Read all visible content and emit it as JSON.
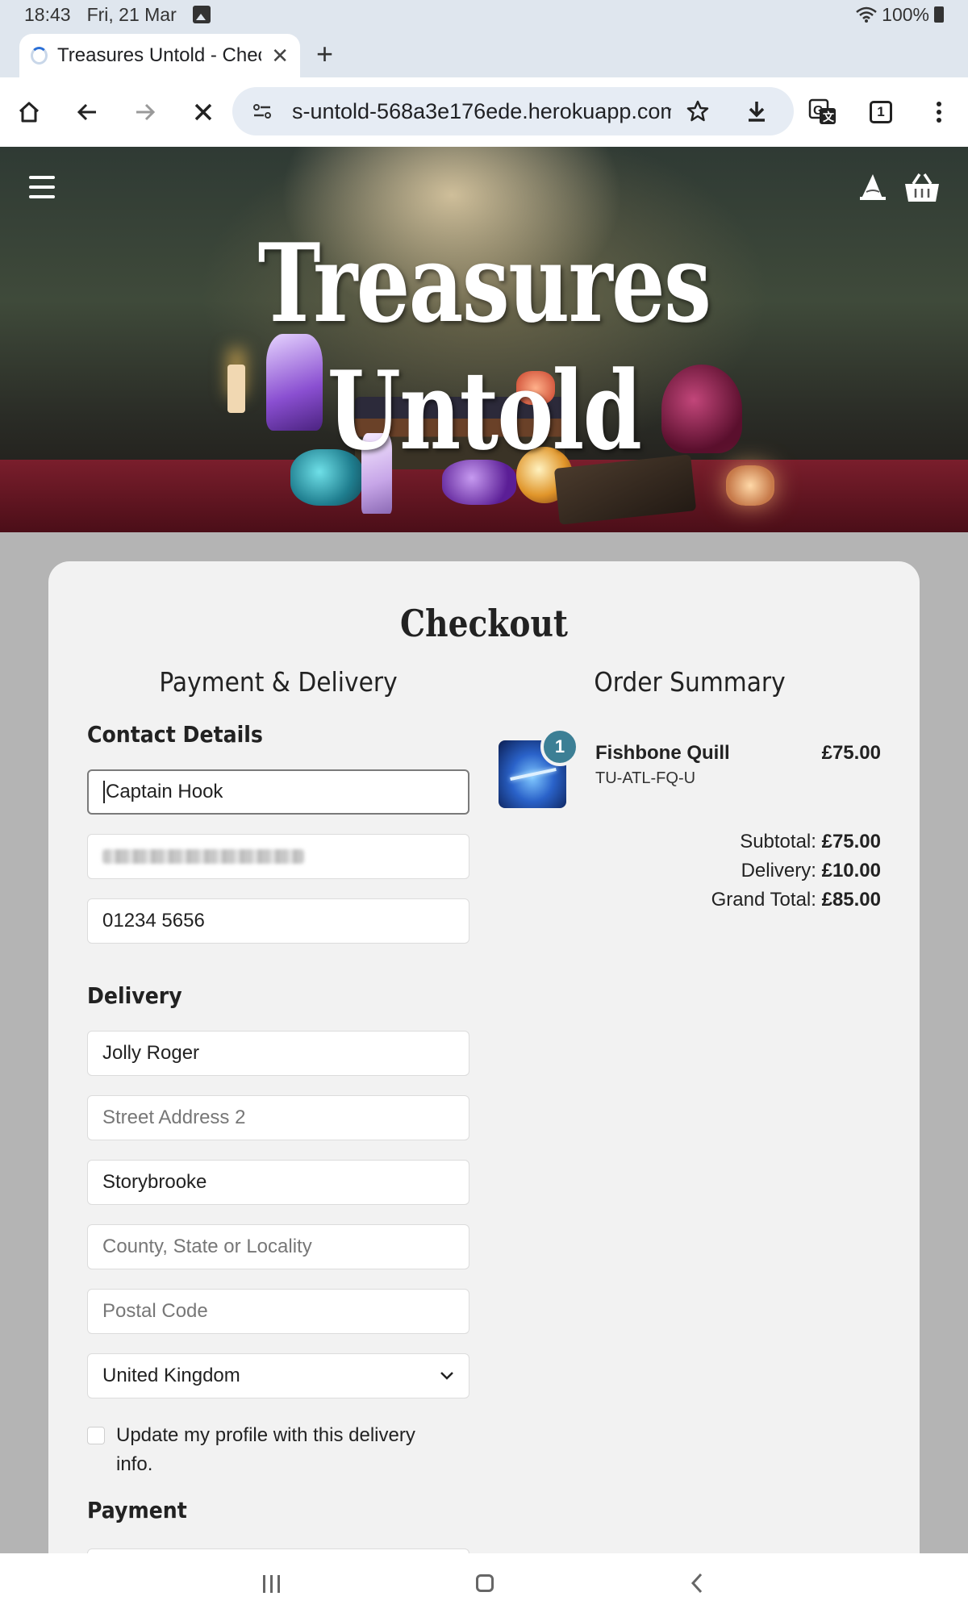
{
  "status_bar": {
    "time": "18:43",
    "date": "Fri, 21 Mar",
    "battery": "100%"
  },
  "browser": {
    "tab_title": "Treasures Untold - Checkout",
    "url": "s-untold-568a3e176ede.herokuapp.com",
    "tab_count": "1",
    "icons": [
      "home-icon",
      "back-icon",
      "forward-icon",
      "stop-icon",
      "site-settings-icon",
      "bookmark-star-icon",
      "download-icon",
      "translate-icon",
      "tabs-icon",
      "more-icon"
    ]
  },
  "site": {
    "brand": "Treasures Untold",
    "icons": [
      "menu-icon",
      "wizard-hat-icon",
      "basket-icon"
    ]
  },
  "checkout": {
    "title": "Checkout",
    "payment_delivery_heading": "Payment & Delivery",
    "order_summary_heading": "Order Summary",
    "contact_heading": "Contact Details",
    "contact": {
      "full_name": "Captain Hook",
      "email": "",
      "phone": "01234 5656"
    },
    "delivery_heading": "Delivery",
    "delivery": {
      "street_address_1": "Jolly Roger",
      "street_address_2_placeholder": "Street Address 2",
      "town": "Storybrooke",
      "county_placeholder": "County, State or Locality",
      "postcode_placeholder": "Postal Code",
      "country": "United Kingdom"
    },
    "save_info_label": "Update my profile with this delivery info.",
    "payment_heading": "Payment"
  },
  "order": {
    "items": [
      {
        "name": "Fishbone Quill",
        "sku": "TU-ATL-FQ-U",
        "price": "£75.00",
        "quantity": "1"
      }
    ],
    "subtotal_label": "Subtotal:",
    "subtotal": "£75.00",
    "delivery_label": "Delivery:",
    "delivery": "£10.00",
    "grand_total_label": "Grand Total:",
    "grand_total": "£85.00"
  },
  "colors": {
    "page_background": "#b4b4b4",
    "card_background": "#f2f2f2",
    "badge": "#3c7f95",
    "browser_chrome": "#dfe6ee"
  }
}
